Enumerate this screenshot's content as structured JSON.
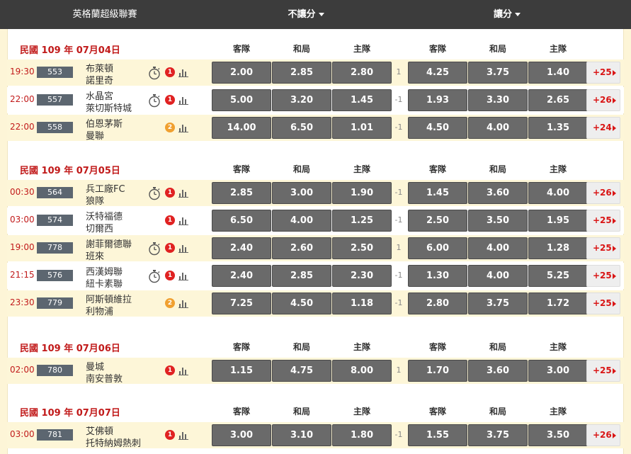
{
  "header": {
    "league": "英格蘭超級聯賽",
    "no_handicap": "不讓分",
    "handicap": "讓分"
  },
  "column_labels": {
    "away": "客隊",
    "draw": "和局",
    "home": "主隊"
  },
  "days": [
    {
      "date": "民國 109 年 07月04日",
      "matches": [
        {
          "time": "19:30",
          "num": "553",
          "team_a": "布萊頓",
          "team_b": "諾里奇",
          "stopwatch": true,
          "badge": "1",
          "badge_color": "#e02222",
          "odds": [
            "2.00",
            "2.85",
            "2.80"
          ],
          "handicap": "1",
          "hodds": [
            "4.25",
            "3.75",
            "1.40"
          ],
          "more": "+25"
        },
        {
          "time": "22:00",
          "num": "557",
          "team_a": "水晶宮",
          "team_b": "萊切斯特城",
          "stopwatch": true,
          "badge": "1",
          "badge_color": "#e02222",
          "odds": [
            "5.00",
            "3.20",
            "1.45"
          ],
          "handicap": "-1",
          "hodds": [
            "1.93",
            "3.30",
            "2.65"
          ],
          "more": "+26"
        },
        {
          "time": "22:00",
          "num": "558",
          "team_a": "伯恩茅斯",
          "team_b": "曼聯",
          "stopwatch": false,
          "badge": "2",
          "badge_color": "#f0a030",
          "odds": [
            "14.00",
            "6.50",
            "1.01"
          ],
          "handicap": "-1",
          "hodds": [
            "4.50",
            "4.00",
            "1.35"
          ],
          "more": "+24"
        }
      ]
    },
    {
      "date": "民國 109 年 07月05日",
      "matches": [
        {
          "time": "00:30",
          "num": "564",
          "team_a": "兵工廠FC",
          "team_b": "狼隊",
          "stopwatch": true,
          "badge": "1",
          "badge_color": "#e02222",
          "odds": [
            "2.85",
            "3.00",
            "1.90"
          ],
          "handicap": "-1",
          "hodds": [
            "1.45",
            "3.60",
            "4.00"
          ],
          "more": "+26"
        },
        {
          "time": "03:00",
          "num": "574",
          "team_a": "沃特福德",
          "team_b": "切爾西",
          "stopwatch": false,
          "badge": "1",
          "badge_color": "#e02222",
          "odds": [
            "6.50",
            "4.00",
            "1.25"
          ],
          "handicap": "-1",
          "hodds": [
            "2.50",
            "3.50",
            "1.95"
          ],
          "more": "+25"
        },
        {
          "time": "19:00",
          "num": "778",
          "team_a": "謝菲爾德聯",
          "team_b": "班來",
          "stopwatch": true,
          "badge": "1",
          "badge_color": "#e02222",
          "odds": [
            "2.40",
            "2.60",
            "2.50"
          ],
          "handicap": "1",
          "hodds": [
            "6.00",
            "4.00",
            "1.28"
          ],
          "more": "+25"
        },
        {
          "time": "21:15",
          "num": "576",
          "team_a": "西漢姆聯",
          "team_b": "紐卡素聯",
          "stopwatch": true,
          "badge": "1",
          "badge_color": "#e02222",
          "odds": [
            "2.40",
            "2.85",
            "2.30"
          ],
          "handicap": "-1",
          "hodds": [
            "1.30",
            "4.00",
            "5.25"
          ],
          "more": "+25"
        },
        {
          "time": "23:30",
          "num": "779",
          "team_a": "阿斯頓維拉",
          "team_b": "利物浦",
          "stopwatch": false,
          "badge": "2",
          "badge_color": "#f0a030",
          "odds": [
            "7.25",
            "4.50",
            "1.18"
          ],
          "handicap": "-1",
          "hodds": [
            "2.80",
            "3.75",
            "1.72"
          ],
          "more": "+25"
        }
      ]
    },
    {
      "date": "民國 109 年 07月06日",
      "matches": [
        {
          "time": "02:00",
          "num": "780",
          "team_a": "曼城",
          "team_b": "南安普敦",
          "stopwatch": false,
          "badge": "1",
          "badge_color": "#e02222",
          "odds": [
            "1.15",
            "4.75",
            "8.00"
          ],
          "handicap": "1",
          "hodds": [
            "1.70",
            "3.60",
            "3.00"
          ],
          "more": "+25"
        }
      ]
    },
    {
      "date": "民國 109 年 07月07日",
      "matches": [
        {
          "time": "03:00",
          "num": "781",
          "team_a": "艾佛頓",
          "team_b": "托特納姆熱刺",
          "stopwatch": false,
          "badge": "1",
          "badge_color": "#e02222",
          "odds": [
            "3.00",
            "3.10",
            "1.80"
          ],
          "handicap": "-1",
          "hodds": [
            "1.55",
            "3.75",
            "3.50"
          ],
          "more": "+26"
        }
      ]
    }
  ]
}
